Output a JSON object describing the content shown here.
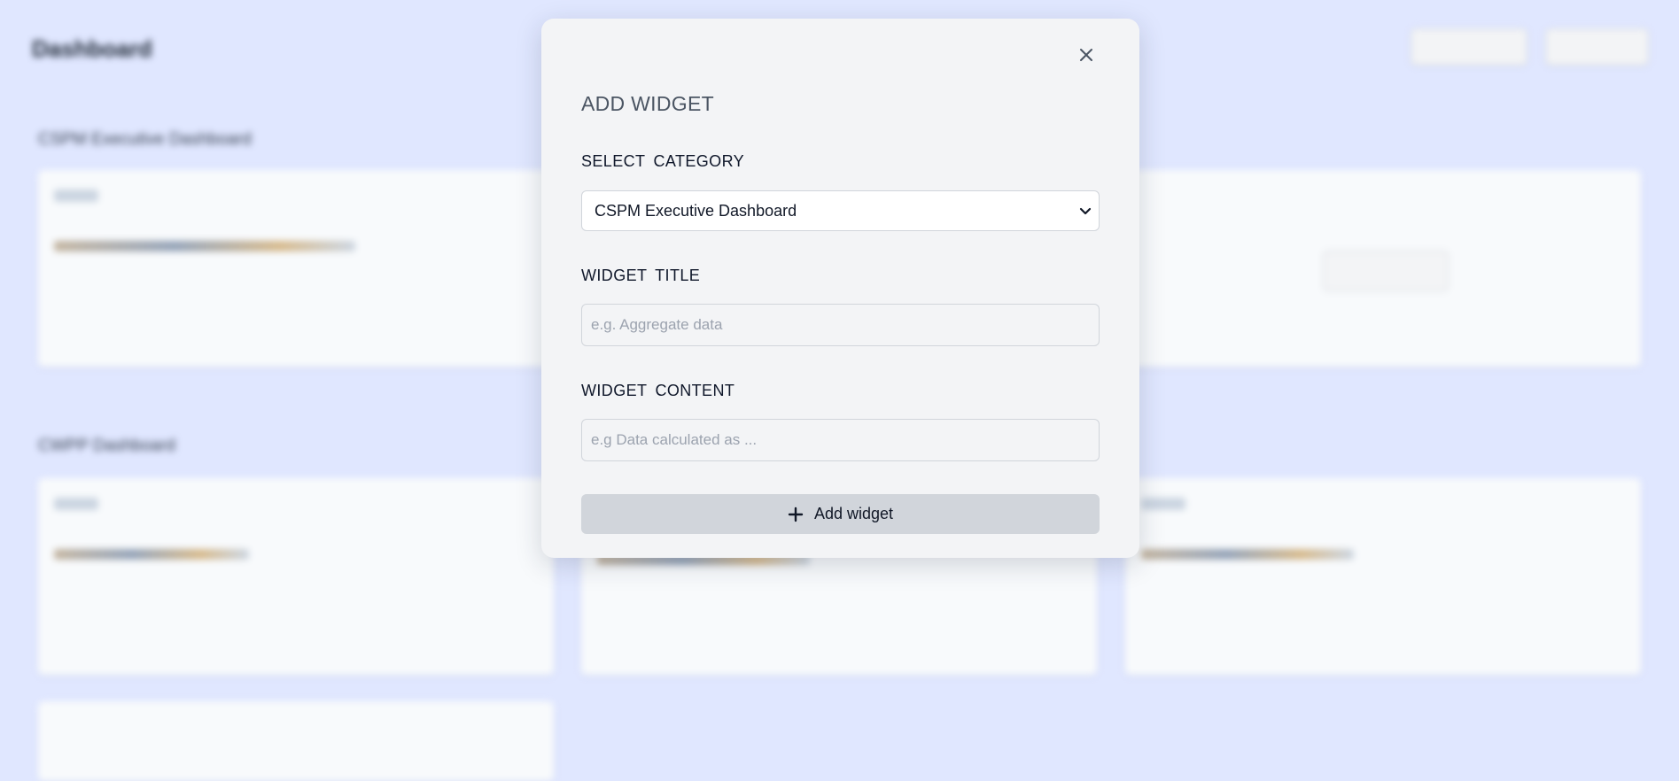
{
  "colors": {
    "page_background": "#e0e7ff",
    "modal_background": "#f3f4f6",
    "button_background": "#d1d5db",
    "title_text": "#4b5563",
    "label_text": "#0f172a",
    "placeholder_text": "#9ca3af"
  },
  "modal": {
    "title": "ADD WIDGET",
    "close_icon": "close-icon",
    "category": {
      "label": "SELECT  CATEGORY",
      "selected_value": "CSPM Executive Dashboard",
      "chevron_icon": "chevron-down-icon"
    },
    "widget_title": {
      "label": "WIDGET  TITLE",
      "placeholder": "e.g. Aggregate data",
      "value": ""
    },
    "widget_content": {
      "label": "WIDGET  CONTENT",
      "placeholder": "e.g Data calculated as ...",
      "value": ""
    },
    "submit": {
      "label": "Add widget",
      "icon": "plus-icon"
    }
  }
}
